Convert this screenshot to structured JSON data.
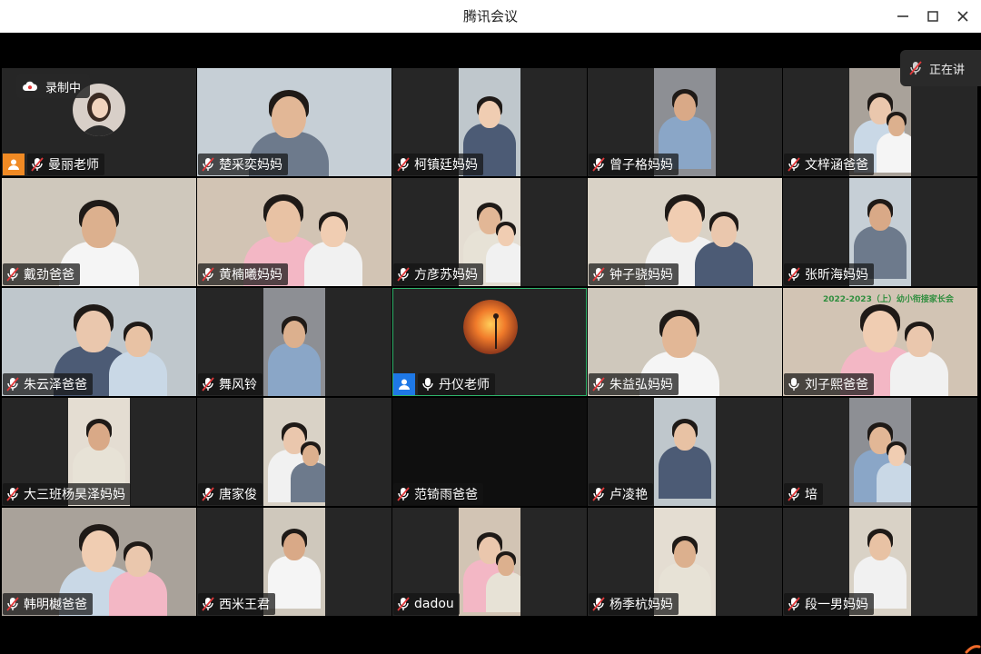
{
  "window": {
    "title": "腾讯会议"
  },
  "recording": {
    "label": "录制中"
  },
  "talking": {
    "label": "正在讲"
  },
  "participants": [
    {
      "name": "曼丽老师",
      "muted": true,
      "role": "host",
      "feed": "avatar"
    },
    {
      "name": "楚采奕妈妈",
      "muted": true,
      "feed": "wide"
    },
    {
      "name": "柯镇廷妈妈",
      "muted": true,
      "feed": "narrow"
    },
    {
      "name": "曾子格妈妈",
      "muted": true,
      "feed": "narrow"
    },
    {
      "name": "文梓涵爸爸",
      "muted": true,
      "feed": "narrow"
    },
    {
      "name": "戴劲爸爸",
      "muted": true,
      "feed": "wide"
    },
    {
      "name": "黄楠曦妈妈",
      "muted": true,
      "feed": "wide"
    },
    {
      "name": "方彦苏妈妈",
      "muted": true,
      "feed": "narrow"
    },
    {
      "name": "钟子骁妈妈",
      "muted": true,
      "feed": "wide"
    },
    {
      "name": "张昕海妈妈",
      "muted": true,
      "feed": "narrow"
    },
    {
      "name": "朱云泽爸爸",
      "muted": true,
      "feed": "wide"
    },
    {
      "name": "舞风铃",
      "muted": true,
      "feed": "narrow"
    },
    {
      "name": "丹仪老师",
      "muted": false,
      "role": "cohost",
      "feed": "logo",
      "active": true
    },
    {
      "name": "朱益弘妈妈",
      "muted": true,
      "feed": "wide"
    },
    {
      "name": "刘子熙爸爸",
      "muted": false,
      "feed": "wide",
      "overlay_text": "2022-2023（上）幼小衔接家长会"
    },
    {
      "name": "大三班杨昊泽妈妈",
      "muted": true,
      "feed": "narrow"
    },
    {
      "name": "唐家俊",
      "muted": true,
      "feed": "narrow"
    },
    {
      "name": "范锜雨爸爸",
      "muted": true,
      "feed": "empty"
    },
    {
      "name": "卢凌艳",
      "muted": true,
      "feed": "narrow"
    },
    {
      "name": "培",
      "muted": true,
      "feed": "narrow"
    },
    {
      "name": "韩明樾爸爸",
      "muted": true,
      "feed": "wide"
    },
    {
      "name": "西米王君",
      "muted": true,
      "feed": "narrow"
    },
    {
      "name": "dadou",
      "muted": true,
      "feed": "narrow"
    },
    {
      "name": "杨季杭妈妈",
      "muted": true,
      "feed": "narrow"
    },
    {
      "name": "段一男妈妈",
      "muted": true,
      "feed": "narrow"
    }
  ],
  "colors": {
    "host_badge": "#f08a24",
    "cohost_badge": "#1e78e6",
    "active_speaker_border": "#2fb36a",
    "muted_mic": "#e0393b"
  },
  "icons": {
    "minimize": "minimize-icon",
    "maximize": "maximize-icon",
    "close": "close-icon",
    "recording": "cloud-record-icon",
    "muted": "mic-muted-icon",
    "unmuted": "mic-icon"
  }
}
